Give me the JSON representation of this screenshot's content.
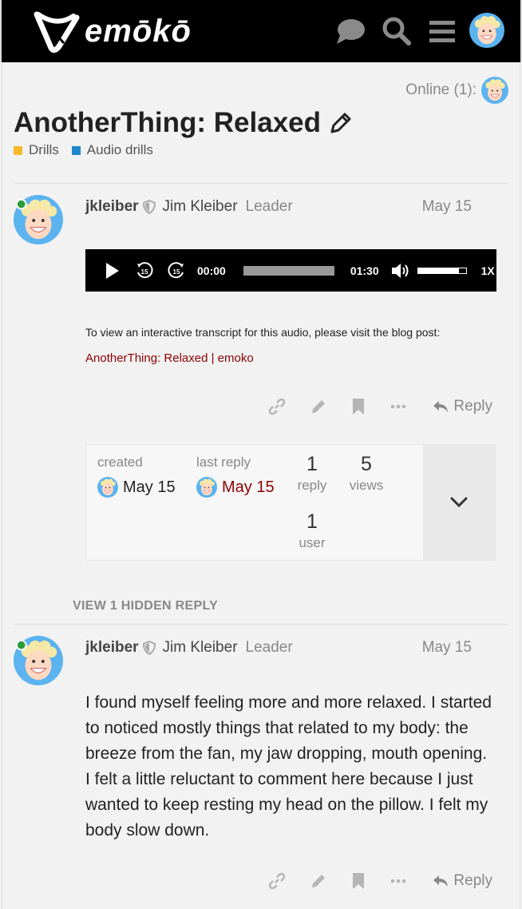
{
  "header": {
    "logo_text": "emōkō",
    "icons": [
      "chat-icon",
      "search-icon",
      "hamburger-menu-icon",
      "user-avatar"
    ]
  },
  "online": {
    "label": "Online (1):"
  },
  "topic": {
    "title": "AnotherThing: Relaxed",
    "categories": [
      {
        "label": "Drills",
        "color": "#f5b82e"
      },
      {
        "label": "Audio drills",
        "color": "#1e88c9"
      }
    ]
  },
  "posts": [
    {
      "username": "jkleiber",
      "full_name": "Jim Kleiber",
      "role": "Leader",
      "date": "May 15",
      "audio": {
        "current_time": "00:00",
        "duration": "01:30",
        "speed": "1X",
        "volume_level": 0.85,
        "skip_back": "15",
        "skip_forward": "15"
      },
      "transcript_text": "To view an interactive transcript for this audio, please visit the blog post:",
      "link_text": "AnotherThing: Relaxed | emoko",
      "reply_label": "Reply"
    },
    {
      "username": "jkleiber",
      "full_name": "Jim Kleiber",
      "role": "Leader",
      "date": "May 15",
      "body": "I found myself feeling more and more relaxed. I started to noticed mostly things that related to my body: the breeze from the fan, my jaw dropping, mouth opening. I felt a little reluctant to comment here because I just wanted to keep resting my head on the pillow. I felt my body slow down.",
      "reply_label": "Reply"
    }
  ],
  "summary": {
    "created_label": "created",
    "created_date": "May 15",
    "last_reply_label": "last reply",
    "last_reply_date": "May 15",
    "replies_count": "1",
    "replies_label": "reply",
    "views_count": "5",
    "views_label": "views",
    "users_count": "1",
    "users_label": "user"
  },
  "hidden_replies": {
    "label": "VIEW 1 HIDDEN REPLY"
  },
  "colors": {
    "link": "#8b0000",
    "header_bg": "#000000"
  }
}
